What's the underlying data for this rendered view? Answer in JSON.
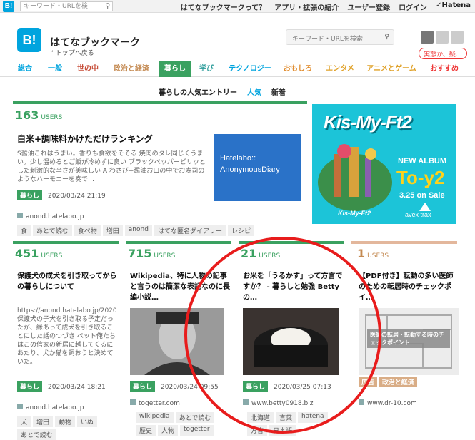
{
  "topbar": {
    "logo": "B!",
    "search_placeholder": "キーワード・URLを検",
    "links": [
      "はてなブックマークって？",
      "アプリ・拡張の紹介",
      "ユーザー登録",
      "ログイン"
    ],
    "hatena": "Hatena"
  },
  "header": {
    "logo": "B!",
    "title": "はてなブックマーク",
    "back": "‘ トップへ戻る",
    "search_placeholder": "キーワード・URLを検索",
    "notice": "実態か、疑…"
  },
  "categories": [
    {
      "label": "総合",
      "color": "#00a4de"
    },
    {
      "label": "一般",
      "color": "#00a4de"
    },
    {
      "label": "世の中",
      "color": "#c64b36"
    },
    {
      "label": "政治と経済",
      "color": "#c48a52"
    },
    {
      "label": "暮らし",
      "color": "#3aa160"
    },
    {
      "label": "学び",
      "color": "#2a9b99"
    },
    {
      "label": "テクノロジー",
      "color": "#00a4de"
    },
    {
      "label": "おもしろ",
      "color": "#e08a2a"
    },
    {
      "label": "エンタメ",
      "color": "#e0a22a"
    },
    {
      "label": "アニメとゲーム",
      "color": "#e0a22a"
    },
    {
      "label": "おすすめ",
      "color": "#e33"
    }
  ],
  "subnav": {
    "title": "暮らしの人気エントリー",
    "popular": "人気",
    "new": "新着"
  },
  "users_label": "USERS",
  "featured": {
    "users": "163",
    "title": "白米+調味料かけただけランキング",
    "desc": "S醤油これはうまい。香りも食欲をそそる 焼肉のタレ同じくうまい。少し温めるとご飯が冷めずに良い ブラックペッパービリッとした刺激的な辛さが美味しい A わさび+醤油お口の中でお寿司のようなハーモニーを奏で…",
    "thumb_line1": "Hatelabo::",
    "thumb_line2": "AnonymousDiary",
    "badge": "暮らし",
    "date": "2020/03/24 21:19",
    "source": "anond.hatelabo.jp",
    "tags": [
      "食",
      "あとで読む",
      "食べ物",
      "増田",
      "anond",
      "はてな匿名ダイアリー",
      "レシピ"
    ]
  },
  "ad": {
    "title": "Kis-My-Ft2",
    "new_album": "NEW ALBUM",
    "album": "To-y2",
    "sale": "3.25 on Sale",
    "label": "avex trax",
    "small": "Kis-My-Ft2"
  },
  "cards": [
    {
      "users": "451",
      "title": "保護犬の成犬を引き取ってから の暮らしについて",
      "desc": "https://anond.hatelabo.jp/20200228200523 保護犬の子犬を引き取る予定だったが、縁あって成犬を引き取ることにした話のつづき ペット俺たちはこの信家の新居に越してくるにあたり、犬か猫を飼おうと決めていた。",
      "badge": "暮らし",
      "date": "2020/03/24 18:21",
      "source": "anond.hatelabo.jp",
      "tags": [
        "犬",
        "増田",
        "動物",
        "いぬ",
        "あとで読む"
      ]
    },
    {
      "users": "715",
      "title": "Wikipedia、特に人物の記事と言うのは簡潔な表記なのに長編小説…",
      "badge": "暮らし",
      "date": "2020/03/24 09:55",
      "source": "togetter.com",
      "tags": [
        "wikipedia",
        "あとで読む",
        "歴史",
        "人物",
        "togetter"
      ]
    },
    {
      "users": "21",
      "title": "お米を「うるかす」って方言ですか？ - 暮らしと勉強 Bettyの…",
      "badge": "暮らし",
      "date": "2020/03/25 07:13",
      "source": "www.betty0918.biz",
      "tags": [
        "北海道",
        "言葉",
        "hatena",
        "方言",
        "日本語"
      ]
    },
    {
      "users": "1",
      "title": "【PDF付き】転動の多い医師のための転居時のチェックポイ…",
      "thumb_text": "医師の転居・転勤する時のチェックポイント",
      "badge": "広告",
      "badge2": "政治と経済",
      "source": "www.dr-10.com"
    }
  ]
}
